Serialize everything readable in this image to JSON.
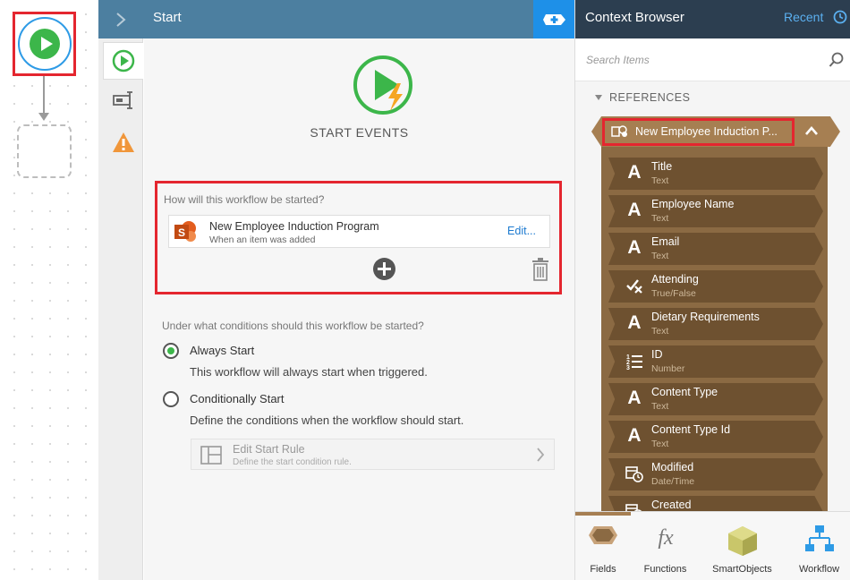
{
  "header": {
    "title": "Start"
  },
  "main": {
    "section_title": "START EVENTS",
    "trigger_question": "How will this workflow be started?",
    "trigger": {
      "name": "New Employee Induction Program",
      "subtitle": "When an item was added",
      "edit_label": "Edit..."
    },
    "conditions_question": "Under what conditions should this workflow be started?",
    "options": [
      {
        "label": "Always Start",
        "description": "This workflow will always start when triggered.",
        "checked": true
      },
      {
        "label": "Conditionally Start",
        "description": "Define the conditions when the workflow should start.",
        "checked": false
      }
    ],
    "rule": {
      "title": "Edit Start Rule",
      "subtitle": "Define the start condition rule."
    }
  },
  "context_browser": {
    "title": "Context Browser",
    "recent_label": "Recent",
    "search_placeholder": "Search Items",
    "references_label": "REFERENCES",
    "reference": {
      "label": "New Employee Induction P..."
    },
    "fields": [
      {
        "name": "Title",
        "type": "Text",
        "icon": "text-icon"
      },
      {
        "name": "Employee Name",
        "type": "Text",
        "icon": "text-icon"
      },
      {
        "name": "Email",
        "type": "Text",
        "icon": "text-icon"
      },
      {
        "name": "Attending",
        "type": "True/False",
        "icon": "boolean-icon"
      },
      {
        "name": "Dietary Requirements",
        "type": "Text",
        "icon": "text-icon"
      },
      {
        "name": "ID",
        "type": "Number",
        "icon": "number-icon"
      },
      {
        "name": "Content Type",
        "type": "Text",
        "icon": "text-icon"
      },
      {
        "name": "Content Type Id",
        "type": "Text",
        "icon": "text-icon"
      },
      {
        "name": "Modified",
        "type": "Date/Time",
        "icon": "datetime-icon"
      },
      {
        "name": "Created",
        "type": "",
        "icon": "datetime-icon"
      }
    ],
    "bottom_tabs": [
      {
        "label": "Fields",
        "icon": "fields-icon"
      },
      {
        "label": "Functions",
        "icon": "functions-icon"
      },
      {
        "label": "SmartObjects",
        "icon": "smartobjects-icon"
      },
      {
        "label": "Workflow",
        "icon": "workflow-icon"
      }
    ]
  },
  "colors": {
    "header_blue": "#4c7fa0",
    "accent_blue": "#1e90e8",
    "context_dark": "#2c3e50",
    "highlight_red": "#e4262f",
    "start_green": "#3cb64a",
    "reference_brown": "#8b6a43",
    "sharepoint_orange": "#e35d1e"
  }
}
